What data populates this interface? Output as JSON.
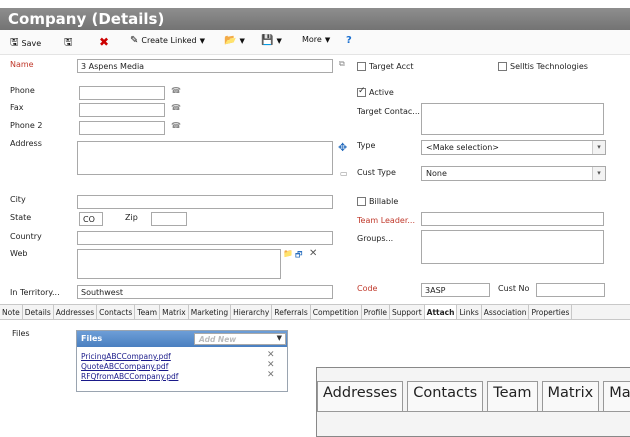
{
  "window": {
    "title": "Company (Details)"
  },
  "toolbar": {
    "save": "Save",
    "create_linked": "Create Linked",
    "more": "More",
    "help": "?"
  },
  "form": {
    "name": {
      "label": "Name",
      "value": "3 Aspens Media"
    },
    "target_acct": {
      "label": "Target Acct",
      "checked": false
    },
    "selltis_tech": {
      "label": "Selltis Technologies",
      "checked": false
    },
    "phone": {
      "label": "Phone",
      "value": ""
    },
    "fax": {
      "label": "Fax",
      "value": ""
    },
    "phone2": {
      "label": "Phone 2",
      "value": ""
    },
    "active": {
      "label": "Active",
      "checked": true
    },
    "target_contact": {
      "label": "Target Contac...",
      "value": ""
    },
    "address": {
      "label": "Address",
      "value": ""
    },
    "type": {
      "label": "Type",
      "value": "<Make selection>"
    },
    "cust_type": {
      "label": "Cust Type",
      "value": "None"
    },
    "city": {
      "label": "City",
      "value": ""
    },
    "billable": {
      "label": "Billable",
      "checked": false
    },
    "state": {
      "label": "State",
      "value": "CO"
    },
    "zip": {
      "label": "Zip",
      "value": ""
    },
    "team_leader": {
      "label": "Team Leader...",
      "value": ""
    },
    "country": {
      "label": "Country",
      "value": ""
    },
    "groups": {
      "label": "Groups...",
      "value": ""
    },
    "web": {
      "label": "Web",
      "value": ""
    },
    "in_territory": {
      "label": "In Territory...",
      "value": "Southwest"
    },
    "code": {
      "label": "Code",
      "value": "3ASP"
    },
    "cust_no": {
      "label": "Cust No",
      "value": ""
    }
  },
  "tabs": [
    "Note",
    "Details",
    "Addresses",
    "Contacts",
    "Team",
    "Matrix",
    "Marketing",
    "Hierarchy",
    "Referrals",
    "Competition",
    "Profile",
    "Support",
    "Attach",
    "Links",
    "Association",
    "Properties"
  ],
  "active_tab": "Attach",
  "files": {
    "label": "Files",
    "header": "Files",
    "add_new": "Add New",
    "items": [
      "PricingABCCompany.pdf",
      "QuoteABCCompany.pdf",
      "RFQfromABCCompany.pdf"
    ]
  },
  "zoom_tabs": [
    "Addresses",
    "Contacts",
    "Team",
    "Matrix",
    "Mark"
  ],
  "colors": {
    "title_bar": "#7f7f7f",
    "required_label": "#c0392b",
    "files_header": "#5a8fcc"
  },
  "icons": [
    "save-icon",
    "save-close-icon",
    "delete-icon",
    "create-linked-icon",
    "folder-icon",
    "disk-icon",
    "help-icon",
    "phone-icon",
    "copy-icon",
    "map-icon",
    "mail-icon",
    "web-icons",
    "remove-icon"
  ]
}
